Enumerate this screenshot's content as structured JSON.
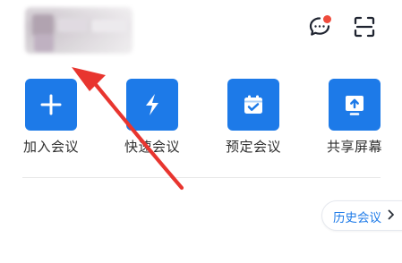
{
  "topbar": {
    "message_icon": "chat-bubble-icon",
    "scan_icon": "scan-icon"
  },
  "actions": [
    {
      "label": "加入会议",
      "icon": "plus-icon"
    },
    {
      "label": "快速会议",
      "icon": "lightning-icon"
    },
    {
      "label": "预定会议",
      "icon": "calendar-check-icon"
    },
    {
      "label": "共享屏幕",
      "icon": "screen-share-icon"
    }
  ],
  "history": {
    "label": "历史会议",
    "icon": "chevron-right-icon"
  },
  "colors": {
    "accent": "#1d7ae8",
    "annotation": "#e8352f",
    "badge": "#ef4b3c"
  }
}
